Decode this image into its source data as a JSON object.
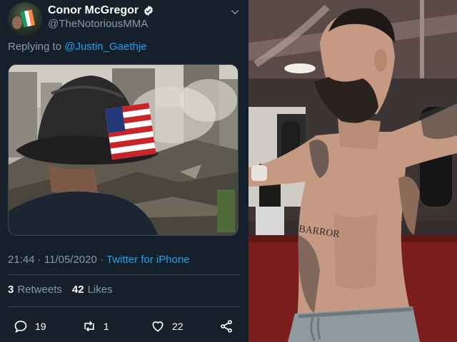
{
  "tweet": {
    "display_name": "Conor McGregor",
    "handle": "@TheNotoriousMMA",
    "reply_prefix": "Replying to",
    "reply_to": "@Justin_Gaethje",
    "time": "21:44 · 11/05/2020 ·",
    "source": "Twitter for iPhone",
    "retweets_count": "3",
    "retweets_label": "Retweets",
    "likes_count": "42",
    "likes_label": "Likes",
    "replies": "19",
    "retweets_action": "1",
    "likes_action": "22"
  },
  "photo_tattoo_text": "BARROR",
  "colors": {
    "background": "#15202b",
    "text_secondary": "#8899a6",
    "accent": "#1da1f2",
    "divider": "#38444d"
  },
  "icons": [
    "verified-icon",
    "chevron-down-icon",
    "reply-icon",
    "retweet-icon",
    "like-icon",
    "share-icon"
  ]
}
